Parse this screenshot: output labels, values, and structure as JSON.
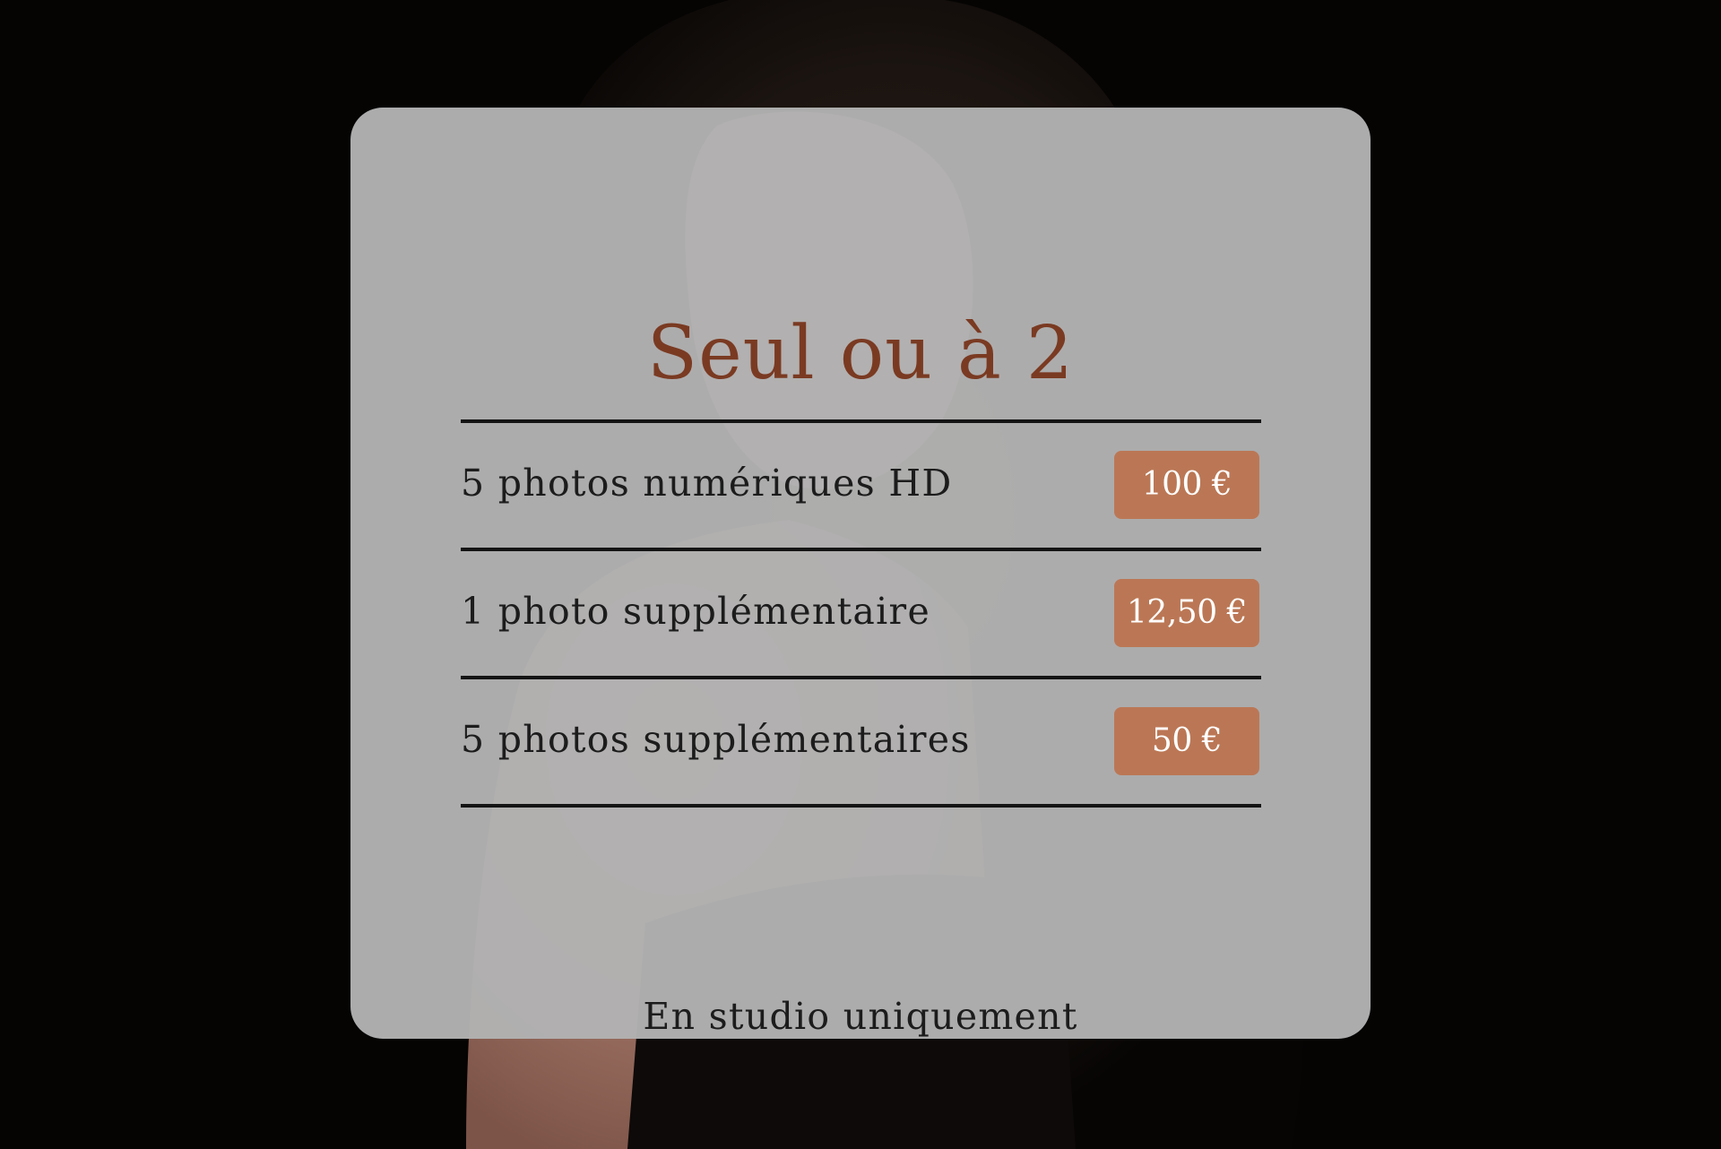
{
  "card": {
    "title": "Seul ou à 2",
    "rows": [
      {
        "label": "5 photos numériques HD",
        "price": "100 €"
      },
      {
        "label": "1 photo supplémentaire",
        "price": "12,50 €"
      },
      {
        "label": "5 photos supplémentaires",
        "price": "50 €"
      }
    ],
    "note": "En studio uniquement"
  },
  "colors": {
    "title": "#7a3a22",
    "price_badge": "#bb7755",
    "card_overlay": "#b2b2b2",
    "background": "#050403"
  }
}
